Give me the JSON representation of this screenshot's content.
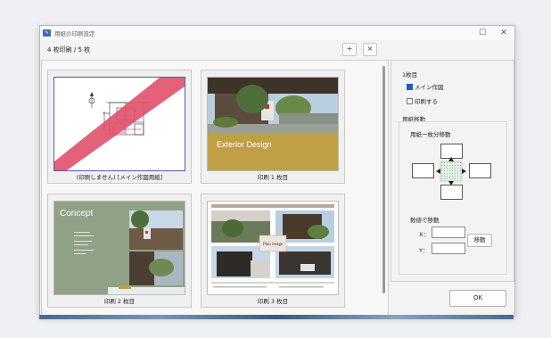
{
  "window": {
    "title": "用紙の印刷設定",
    "maximize_glyph": "☐",
    "close_glyph": "✕"
  },
  "toolbar": {
    "page_count": "4 枚印刷 / 5 枚",
    "add_label": "+",
    "remove_label": "×"
  },
  "cards": [
    {
      "caption": "(印刷しません) [メイン作図用紙]"
    },
    {
      "caption": "印刷 1 枚目",
      "banner_title": "Exterior Design"
    },
    {
      "caption": "印刷 2 枚目",
      "concept_title": "Concept"
    },
    {
      "caption": "印刷 3 枚目",
      "plan_label": "Plan image"
    }
  ],
  "panel": {
    "sheet_label": "1枚目",
    "main_drawing_label": "メイン作図",
    "main_drawing_checked": true,
    "print_label": "印刷する",
    "print_checked": false,
    "move_group_label": "用紙移動",
    "one_sheet_move_label": "用紙一枚分移動",
    "numeric_move_label": "数値で移動",
    "x_label": "X：",
    "y_label": "Y：",
    "x_value": "",
    "y_value": "",
    "move_button": "移動"
  },
  "ok_button": "OK",
  "colors": {
    "accent": "#1e5fb8",
    "banner": "#c19f45",
    "concept_bg": "#8fa287",
    "strike": "#e0506a"
  }
}
